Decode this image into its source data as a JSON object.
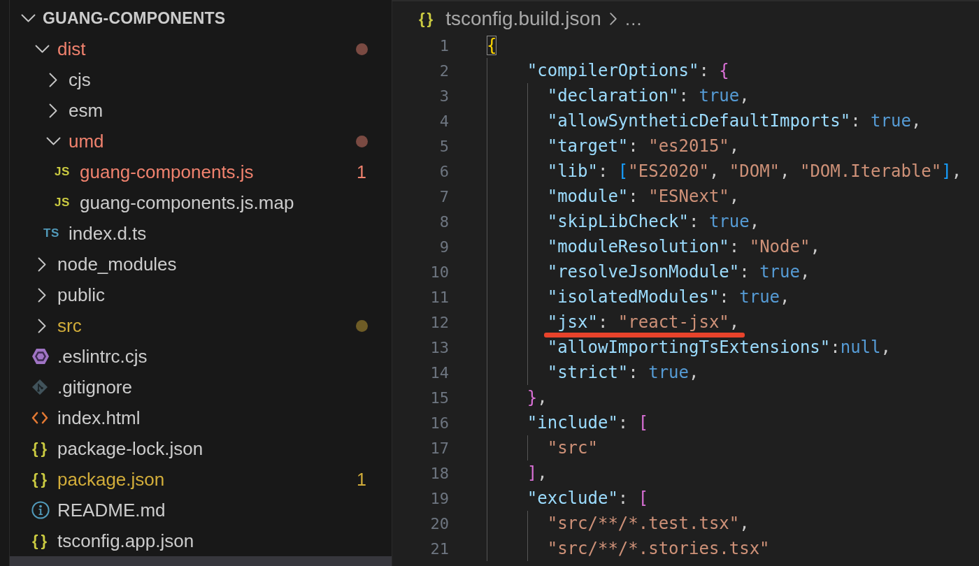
{
  "explorer": {
    "root": {
      "label": "GUANG-COMPONENTS",
      "expanded": true
    },
    "items": [
      {
        "label": "dist",
        "kind": "folder",
        "expanded": true,
        "error": true,
        "warning": false,
        "dot": true,
        "selected": false,
        "children": [
          {
            "label": "cjs",
            "kind": "folder",
            "expanded": false,
            "error": false,
            "warning": false,
            "dot": false,
            "selected": false
          },
          {
            "label": "esm",
            "kind": "folder",
            "expanded": false,
            "error": false,
            "warning": false,
            "dot": false,
            "selected": false
          },
          {
            "label": "umd",
            "kind": "folder",
            "expanded": true,
            "error": true,
            "warning": false,
            "dot": true,
            "selected": false,
            "children": [
              {
                "label": "guang-components.js",
                "kind": "letters",
                "glyph": "JS",
                "color": "#cbcb41",
                "error": true,
                "warning": false,
                "count": "1",
                "selected": false
              },
              {
                "label": "guang-components.js.map",
                "kind": "letters",
                "glyph": "JS",
                "color": "#cbcb41",
                "error": false,
                "warning": false,
                "selected": false
              }
            ]
          },
          {
            "label": "index.d.ts",
            "kind": "letters",
            "glyph": "TS",
            "color": "#519aba",
            "error": false,
            "warning": false,
            "selected": false
          }
        ]
      },
      {
        "label": "node_modules",
        "kind": "folder",
        "expanded": false,
        "error": false,
        "warning": false,
        "dot": false,
        "selected": false
      },
      {
        "label": "public",
        "kind": "folder",
        "expanded": false,
        "error": false,
        "warning": false,
        "dot": false,
        "selected": false
      },
      {
        "label": "src",
        "kind": "folder",
        "expanded": false,
        "error": false,
        "warning": true,
        "dot": true,
        "selected": false
      },
      {
        "label": ".eslintrc.cjs",
        "kind": "hexagon",
        "error": false,
        "warning": false,
        "selected": false
      },
      {
        "label": ".gitignore",
        "kind": "diamond",
        "error": false,
        "warning": false,
        "selected": false
      },
      {
        "label": "index.html",
        "kind": "angle",
        "error": false,
        "warning": false,
        "selected": false
      },
      {
        "label": "package-lock.json",
        "kind": "braces",
        "glyph": "{}",
        "color": "#cbcb41",
        "error": false,
        "warning": false,
        "selected": false
      },
      {
        "label": "package.json",
        "kind": "braces",
        "glyph": "{}",
        "color": "#cbcb41",
        "error": false,
        "warning": true,
        "count": "1",
        "selected": false
      },
      {
        "label": "README.md",
        "kind": "info",
        "error": false,
        "warning": false,
        "selected": false
      },
      {
        "label": "tsconfig.app.json",
        "kind": "braces",
        "glyph": "{}",
        "color": "#cbcb41",
        "error": false,
        "warning": false,
        "selected": false
      },
      {
        "selected": true
      }
    ]
  },
  "editor": {
    "breadcrumb": {
      "glyph": "{}",
      "file": "tsconfig.build.json",
      "more": "…"
    },
    "lines": [
      {
        "number": "1",
        "underlined": false,
        "tokens": [
          {
            "kind": "bracket1",
            "text": "{",
            "boxed": true
          }
        ],
        "children": [
          {
            "number": "2",
            "underlined": false,
            "tokens": [
              {
                "kind": "key",
                "text": "\"compilerOptions\""
              },
              {
                "kind": "punct",
                "text": ": "
              },
              {
                "kind": "bracket2",
                "text": "{"
              }
            ],
            "children": [
              {
                "number": "3",
                "underlined": false,
                "tokens": [
                  {
                    "kind": "key",
                    "text": "\"declaration\""
                  },
                  {
                    "kind": "punct",
                    "text": ": "
                  },
                  {
                    "kind": "keyword",
                    "text": "true"
                  },
                  {
                    "kind": "punct",
                    "text": ","
                  }
                ]
              },
              {
                "number": "4",
                "underlined": false,
                "tokens": [
                  {
                    "kind": "key",
                    "text": "\"allowSyntheticDefaultImports\""
                  },
                  {
                    "kind": "punct",
                    "text": ": "
                  },
                  {
                    "kind": "keyword",
                    "text": "true"
                  },
                  {
                    "kind": "punct",
                    "text": ","
                  }
                ]
              },
              {
                "number": "5",
                "underlined": false,
                "tokens": [
                  {
                    "kind": "key",
                    "text": "\"target\""
                  },
                  {
                    "kind": "punct",
                    "text": ": "
                  },
                  {
                    "kind": "string",
                    "text": "\"es2015\""
                  },
                  {
                    "kind": "punct",
                    "text": ","
                  }
                ]
              },
              {
                "number": "6",
                "underlined": false,
                "tokens": [
                  {
                    "kind": "key",
                    "text": "\"lib\""
                  },
                  {
                    "kind": "punct",
                    "text": ": "
                  },
                  {
                    "kind": "bracket3",
                    "text": "["
                  },
                  {
                    "kind": "string",
                    "text": "\"ES2020\""
                  },
                  {
                    "kind": "punct",
                    "text": ", "
                  },
                  {
                    "kind": "string",
                    "text": "\"DOM\""
                  },
                  {
                    "kind": "punct",
                    "text": ", "
                  },
                  {
                    "kind": "string",
                    "text": "\"DOM.Iterable\""
                  },
                  {
                    "kind": "bracket3",
                    "text": "]"
                  },
                  {
                    "kind": "punct",
                    "text": ","
                  }
                ]
              },
              {
                "number": "7",
                "underlined": false,
                "tokens": [
                  {
                    "kind": "key",
                    "text": "\"module\""
                  },
                  {
                    "kind": "punct",
                    "text": ": "
                  },
                  {
                    "kind": "string",
                    "text": "\"ESNext\""
                  },
                  {
                    "kind": "punct",
                    "text": ","
                  }
                ]
              },
              {
                "number": "8",
                "underlined": false,
                "tokens": [
                  {
                    "kind": "key",
                    "text": "\"skipLibCheck\""
                  },
                  {
                    "kind": "punct",
                    "text": ": "
                  },
                  {
                    "kind": "keyword",
                    "text": "true"
                  },
                  {
                    "kind": "punct",
                    "text": ","
                  }
                ]
              },
              {
                "number": "9",
                "underlined": false,
                "tokens": [
                  {
                    "kind": "key",
                    "text": "\"moduleResolution\""
                  },
                  {
                    "kind": "punct",
                    "text": ": "
                  },
                  {
                    "kind": "string",
                    "text": "\"Node\""
                  },
                  {
                    "kind": "punct",
                    "text": ","
                  }
                ]
              },
              {
                "number": "10",
                "underlined": false,
                "tokens": [
                  {
                    "kind": "key",
                    "text": "\"resolveJsonModule\""
                  },
                  {
                    "kind": "punct",
                    "text": ": "
                  },
                  {
                    "kind": "keyword",
                    "text": "true"
                  },
                  {
                    "kind": "punct",
                    "text": ","
                  }
                ]
              },
              {
                "number": "11",
                "underlined": false,
                "tokens": [
                  {
                    "kind": "key",
                    "text": "\"isolatedModules\""
                  },
                  {
                    "kind": "punct",
                    "text": ": "
                  },
                  {
                    "kind": "keyword",
                    "text": "true"
                  },
                  {
                    "kind": "punct",
                    "text": ","
                  }
                ]
              },
              {
                "number": "12",
                "underlined": true,
                "tokens": [
                  {
                    "kind": "key",
                    "text": "\"jsx\""
                  },
                  {
                    "kind": "punct",
                    "text": ": "
                  },
                  {
                    "kind": "string",
                    "text": "\"react-jsx\""
                  },
                  {
                    "kind": "punct",
                    "text": ","
                  }
                ]
              },
              {
                "number": "13",
                "underlined": false,
                "tokens": [
                  {
                    "kind": "key",
                    "text": "\"allowImportingTsExtensions\""
                  },
                  {
                    "kind": "punct",
                    "text": ":"
                  },
                  {
                    "kind": "keyword",
                    "text": "null"
                  },
                  {
                    "kind": "punct",
                    "text": ","
                  }
                ]
              },
              {
                "number": "14",
                "underlined": false,
                "tokens": [
                  {
                    "kind": "key",
                    "text": "\"strict\""
                  },
                  {
                    "kind": "punct",
                    "text": ": "
                  },
                  {
                    "kind": "keyword",
                    "text": "true"
                  },
                  {
                    "kind": "punct",
                    "text": ","
                  }
                ]
              }
            ]
          },
          {
            "number": "15",
            "underlined": false,
            "tokens": [
              {
                "kind": "bracket2",
                "text": "}"
              },
              {
                "kind": "punct",
                "text": ","
              }
            ]
          },
          {
            "number": "16",
            "underlined": false,
            "tokens": [
              {
                "kind": "key",
                "text": "\"include\""
              },
              {
                "kind": "punct",
                "text": ": "
              },
              {
                "kind": "bracket2",
                "text": "["
              }
            ],
            "children": [
              {
                "number": "17",
                "underlined": false,
                "tokens": [
                  {
                    "kind": "string",
                    "text": "\"src\""
                  }
                ]
              }
            ]
          },
          {
            "number": "18",
            "underlined": false,
            "tokens": [
              {
                "kind": "bracket2",
                "text": "]"
              },
              {
                "kind": "punct",
                "text": ","
              }
            ]
          },
          {
            "number": "19",
            "underlined": false,
            "tokens": [
              {
                "kind": "key",
                "text": "\"exclude\""
              },
              {
                "kind": "punct",
                "text": ": "
              },
              {
                "kind": "bracket2",
                "text": "["
              }
            ],
            "children": [
              {
                "number": "20",
                "underlined": false,
                "tokens": [
                  {
                    "kind": "string",
                    "text": "\"src/**/*.test.tsx\""
                  },
                  {
                    "kind": "punct",
                    "text": ","
                  }
                ]
              },
              {
                "number": "21",
                "underlined": false,
                "tokens": [
                  {
                    "kind": "string",
                    "text": "\"src/**/*.stories.tsx\""
                  }
                ]
              }
            ]
          }
        ]
      }
    ]
  }
}
